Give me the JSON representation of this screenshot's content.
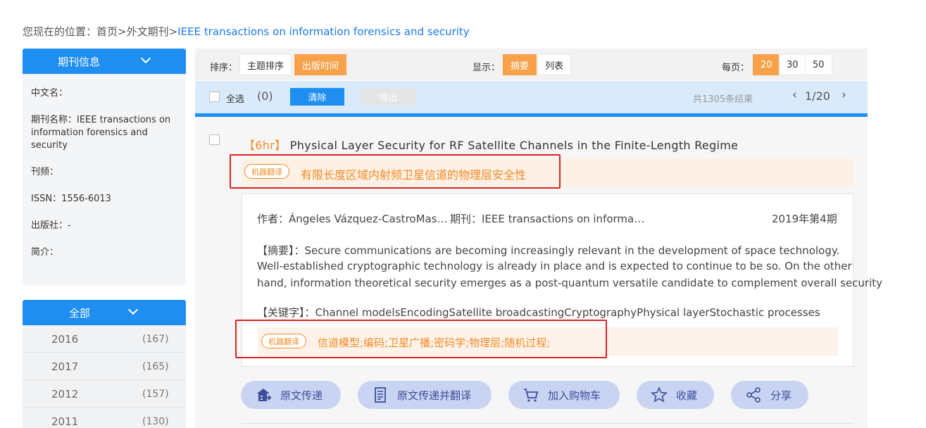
{
  "breadcrumb": {
    "prefix": "您现在的位置：",
    "home": "首页",
    "section": "外文期刊",
    "current": "IEEE transactions on information forensics and security",
    "sep": ">"
  },
  "sidebar": {
    "info_title": "期刊信息",
    "fields": [
      "中文名：",
      "期刊名称：IEEE transactions on information forensics and security",
      "刊频：",
      "ISSN：1556-6013",
      "出版社：-",
      "简介："
    ],
    "year_title": "全部",
    "years": [
      {
        "year": "2016",
        "count": "(167)"
      },
      {
        "year": "2017",
        "count": "(165)"
      },
      {
        "year": "2012",
        "count": "(157)"
      },
      {
        "year": "2011",
        "count": "(130)"
      }
    ]
  },
  "toolbar": {
    "sort_label": "排序：",
    "sort_topic": "主题排序",
    "sort_date": "出版时间",
    "display_label": "显示：",
    "display_abstract": "摘要",
    "display_list": "列表",
    "per_page_label": "每页：",
    "per_page_options": [
      "20",
      "30",
      "50"
    ]
  },
  "selection": {
    "select_all": "全选",
    "count": "(0)",
    "clear": "清除",
    "export": "导出",
    "total": "共1305条结果",
    "page": "1/20"
  },
  "result": {
    "tag": "【6hr】",
    "title": "Physical Layer Security for RF Satellite Channels in the Finite-Length Regime",
    "mt_badge": "机器翻译",
    "title_translation": "有限长度区域内射频卫星信道的物理层安全性",
    "meta_authors": "作者：Ángeles Vázquez-CastroMas…",
    "meta_journal": "期刊：IEEE transactions on informa…",
    "meta_issue": "2019年第4期",
    "abstract_label": "【摘要】",
    "abstract_lines": [
      "：Secure communications are becoming increasingly relevant in the development of space technology.",
      "Well-established cryptographic technology is already in place and is expected to continue to be so. On the other",
      "hand, information theoretical security emerges as a post-quantum versatile candidate to complement overall security"
    ],
    "keywords_label": "【关键字】",
    "keywords": "：Channel modelsEncodingSatellite broadcastingCryptographyPhysical layerStochastic processes",
    "keywords_translation": "信道模型;编码;卫星广播;密码学;物理层;随机过程;"
  },
  "actions": {
    "deliver": "原文传递",
    "deliver_translate": "原文传递并翻译",
    "cart": "加入购物车",
    "favorite": "收藏",
    "share": "分享"
  },
  "colors": {
    "primary_blue": "#1e8ef0",
    "accent_orange": "#f28c28",
    "highlight_red": "#e02020",
    "action_bg": "#c9d3f2"
  }
}
